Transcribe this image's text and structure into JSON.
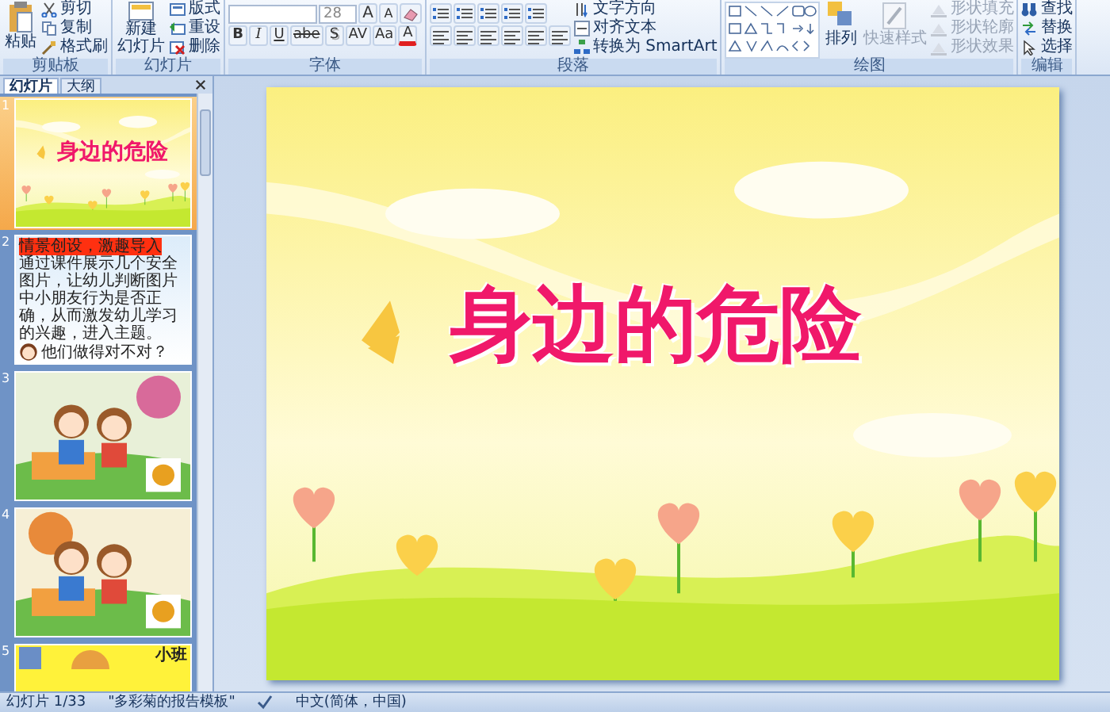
{
  "ribbon": {
    "clipboard": {
      "label": "剪贴板",
      "paste": "粘贴",
      "cut": "剪切",
      "copy": "复制",
      "format_painter": "格式刷"
    },
    "slides": {
      "label": "幻灯片",
      "new_slide": [
        "新建",
        "幻灯片"
      ],
      "layout": "版式",
      "reset": "重设",
      "delete": "删除"
    },
    "font": {
      "label": "字体",
      "size": "28",
      "grow": "A",
      "shrink": "A",
      "styles": [
        "B",
        "I",
        "U",
        "abe",
        "S",
        "AV",
        "Aa",
        "A"
      ]
    },
    "paragraph": {
      "label": "段落",
      "text_direction": "文字方向",
      "align_text": "对齐文本",
      "smartart": "转换为 SmartArt"
    },
    "drawing": {
      "label": "绘图",
      "arrange": "排列",
      "quick_styles": {
        "label": "快速样式",
        "disabled": true
      },
      "shape_tools": [
        {
          "label": "形状填充",
          "disabled": true
        },
        {
          "label": "形状轮廓",
          "disabled": true
        },
        {
          "label": "形状效果",
          "disabled": true
        }
      ]
    },
    "editing": {
      "label": "编辑",
      "items": [
        "查找",
        "替换",
        "选择"
      ]
    }
  },
  "slides_pane": {
    "tabs": [
      {
        "label": "幻灯片",
        "selected": true
      },
      {
        "label": "大纲",
        "selected": false
      }
    ],
    "thumbnails": [
      {
        "number": "1",
        "kind": "title",
        "selected": true,
        "title": "身边的危险"
      },
      {
        "number": "2",
        "kind": "text",
        "selected": false,
        "heading": "情景创设，激趣导入",
        "body": "通过课件展示几个安全图片，让幼儿判断图片中小朋友行为是否正确，从而激发幼儿学习的兴趣，进入主题。",
        "question": "他们做得对不对？"
      },
      {
        "number": "3",
        "kind": "picture",
        "selected": false
      },
      {
        "number": "4",
        "kind": "picture",
        "selected": false
      },
      {
        "number": "5",
        "kind": "label",
        "selected": false,
        "label": "小班"
      }
    ]
  },
  "slide": {
    "title": "身边的危险"
  },
  "status_bar": {
    "slide": "幻灯片 1/33",
    "theme": "\"多彩菊的报告模板\"",
    "language": "中文(简体，中国)"
  }
}
